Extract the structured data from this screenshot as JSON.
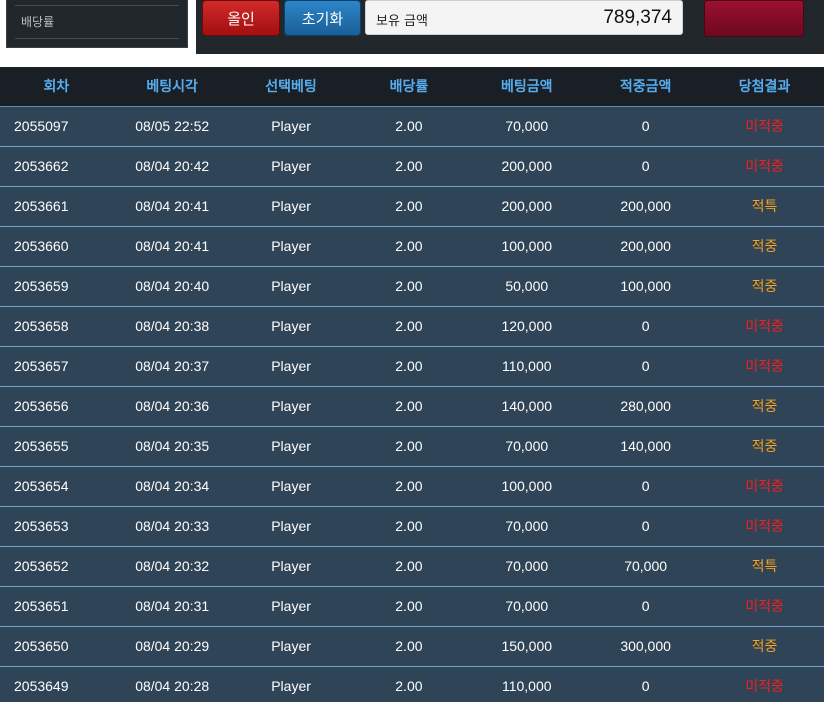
{
  "sidebar": {
    "odds_label": "배당률"
  },
  "controls": {
    "allin_label": "올인",
    "reset_label": "초기화",
    "balance_label": "보유 금액",
    "balance_value": "789,374",
    "bet_label": ""
  },
  "colors": {
    "header_text": "#56aef0",
    "miss": "#f02020",
    "hit": "#f7a21b",
    "row_bg": "#2f4456"
  },
  "table": {
    "headers": [
      "회차",
      "베팅시각",
      "선택베팅",
      "배당률",
      "베팅금액",
      "적중금액",
      "당첨결과"
    ],
    "rows": [
      {
        "round": "2055097",
        "time": "08/05 22:52",
        "pick": "Player",
        "odds": "2.00",
        "bet": "70,000",
        "win": "0",
        "result": "미적중",
        "status": "miss"
      },
      {
        "round": "2053662",
        "time": "08/04 20:42",
        "pick": "Player",
        "odds": "2.00",
        "bet": "200,000",
        "win": "0",
        "result": "미적중",
        "status": "miss"
      },
      {
        "round": "2053661",
        "time": "08/04 20:41",
        "pick": "Player",
        "odds": "2.00",
        "bet": "200,000",
        "win": "200,000",
        "result": "적특",
        "status": "hit"
      },
      {
        "round": "2053660",
        "time": "08/04 20:41",
        "pick": "Player",
        "odds": "2.00",
        "bet": "100,000",
        "win": "200,000",
        "result": "적중",
        "status": "hit"
      },
      {
        "round": "2053659",
        "time": "08/04 20:40",
        "pick": "Player",
        "odds": "2.00",
        "bet": "50,000",
        "win": "100,000",
        "result": "적중",
        "status": "hit"
      },
      {
        "round": "2053658",
        "time": "08/04 20:38",
        "pick": "Player",
        "odds": "2.00",
        "bet": "120,000",
        "win": "0",
        "result": "미적중",
        "status": "miss"
      },
      {
        "round": "2053657",
        "time": "08/04 20:37",
        "pick": "Player",
        "odds": "2.00",
        "bet": "110,000",
        "win": "0",
        "result": "미적중",
        "status": "miss"
      },
      {
        "round": "2053656",
        "time": "08/04 20:36",
        "pick": "Player",
        "odds": "2.00",
        "bet": "140,000",
        "win": "280,000",
        "result": "적중",
        "status": "hit"
      },
      {
        "round": "2053655",
        "time": "08/04 20:35",
        "pick": "Player",
        "odds": "2.00",
        "bet": "70,000",
        "win": "140,000",
        "result": "적중",
        "status": "hit"
      },
      {
        "round": "2053654",
        "time": "08/04 20:34",
        "pick": "Player",
        "odds": "2.00",
        "bet": "100,000",
        "win": "0",
        "result": "미적중",
        "status": "miss"
      },
      {
        "round": "2053653",
        "time": "08/04 20:33",
        "pick": "Player",
        "odds": "2.00",
        "bet": "70,000",
        "win": "0",
        "result": "미적중",
        "status": "miss"
      },
      {
        "round": "2053652",
        "time": "08/04 20:32",
        "pick": "Player",
        "odds": "2.00",
        "bet": "70,000",
        "win": "70,000",
        "result": "적특",
        "status": "hit"
      },
      {
        "round": "2053651",
        "time": "08/04 20:31",
        "pick": "Player",
        "odds": "2.00",
        "bet": "70,000",
        "win": "0",
        "result": "미적중",
        "status": "miss"
      },
      {
        "round": "2053650",
        "time": "08/04 20:29",
        "pick": "Player",
        "odds": "2.00",
        "bet": "150,000",
        "win": "300,000",
        "result": "적중",
        "status": "hit"
      },
      {
        "round": "2053649",
        "time": "08/04 20:28",
        "pick": "Player",
        "odds": "2.00",
        "bet": "110,000",
        "win": "0",
        "result": "미적중",
        "status": "miss"
      }
    ]
  }
}
